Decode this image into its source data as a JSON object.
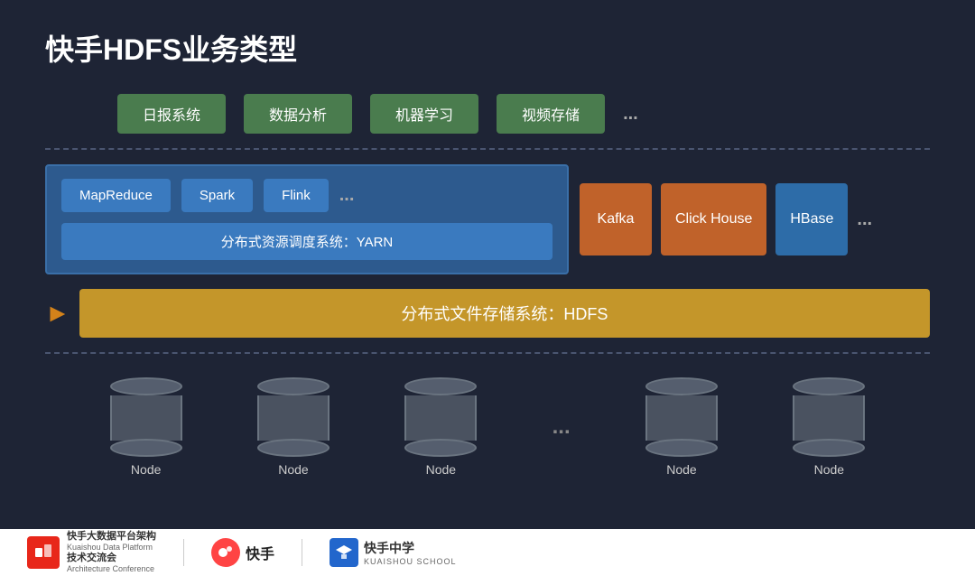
{
  "title": "快手HDFS业务类型",
  "top_row": {
    "items": [
      "日报系统",
      "数据分析",
      "机器学习",
      "视频存储"
    ],
    "dots": "..."
  },
  "middle": {
    "blue_boxes": [
      "MapReduce",
      "Spark",
      "Flink"
    ],
    "blue_dots": "...",
    "yarn_label": "分布式资源调度系统：YARN",
    "kafka_label": "Kafka",
    "clickhouse_label": "Click House",
    "hbase_label": "HBase",
    "right_dots": "..."
  },
  "hdfs": {
    "label": "分布式文件存储系统：HDFS"
  },
  "nodes": {
    "items": [
      "Node",
      "Node",
      "Node",
      "Node",
      "Node"
    ],
    "dots": "..."
  },
  "footer": {
    "logo1_main": "快手大数据平台架构",
    "logo1_sub1": "Kuaishou Data Platform",
    "logo1_sub2": "技术交流会",
    "logo1_sub3": "Architecture Conference",
    "logo2_label": "快手",
    "logo3_label": "快手中学",
    "logo3_sub": "KUAISHOU SCHOOL"
  }
}
